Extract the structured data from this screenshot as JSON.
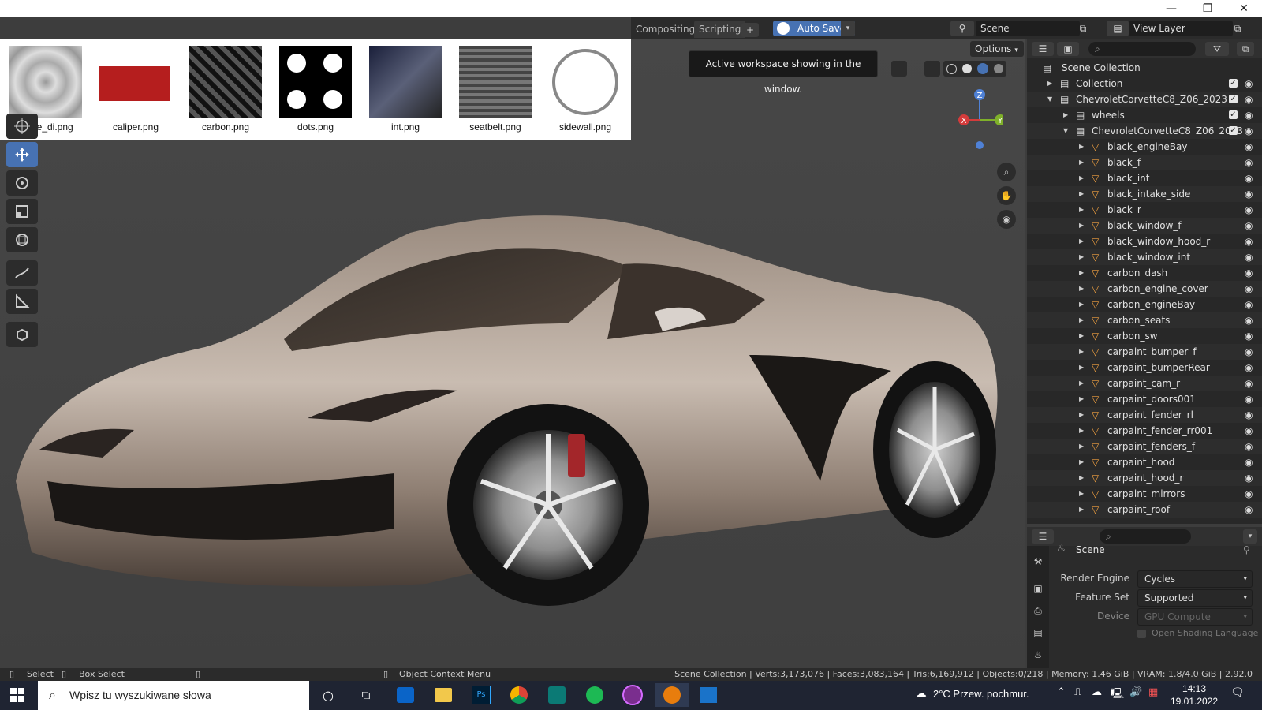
{
  "window": {
    "minimize": "—",
    "restore": "❐",
    "close": "✕"
  },
  "workspace_tabs": [
    {
      "label": "Compositing"
    },
    {
      "label": "Scripting"
    },
    {
      "label": "+"
    }
  ],
  "header": {
    "auto_save": "Auto Save",
    "scene_name": "Scene",
    "view_layer": "View Layer",
    "options": "Options"
  },
  "tooltip": "Active workspace showing in the window.",
  "image_strip": [
    {
      "name": "brake_di.png"
    },
    {
      "name": "caliper.png"
    },
    {
      "name": "carbon.png"
    },
    {
      "name": "dots.png"
    },
    {
      "name": "int.png"
    },
    {
      "name": "seatbelt.png"
    },
    {
      "name": "sidewall.png"
    }
  ],
  "gizmo": {
    "z": "Z",
    "y": "Y",
    "x": "X"
  },
  "outliner": {
    "title": "Scene Collection",
    "rows": [
      {
        "label": "Collection",
        "indent": 1
      },
      {
        "label": "ChevroletCorvetteC8_Z06_2023",
        "indent": 1
      },
      {
        "label": "wheels",
        "indent": 2
      },
      {
        "label": "ChevroletCorvetteC8_Z06_2023",
        "indent": 2
      },
      {
        "label": "black_engineBay",
        "indent": 3
      },
      {
        "label": "black_f",
        "indent": 3
      },
      {
        "label": "black_int",
        "indent": 3
      },
      {
        "label": "black_intake_side",
        "indent": 3
      },
      {
        "label": "black_r",
        "indent": 3
      },
      {
        "label": "black_window_f",
        "indent": 3
      },
      {
        "label": "black_window_hood_r",
        "indent": 3
      },
      {
        "label": "black_window_int",
        "indent": 3
      },
      {
        "label": "carbon_dash",
        "indent": 3
      },
      {
        "label": "carbon_engine_cover",
        "indent": 3
      },
      {
        "label": "carbon_engineBay",
        "indent": 3
      },
      {
        "label": "carbon_seats",
        "indent": 3
      },
      {
        "label": "carbon_sw",
        "indent": 3
      },
      {
        "label": "carpaint_bumper_f",
        "indent": 3
      },
      {
        "label": "carpaint_bumperRear",
        "indent": 3
      },
      {
        "label": "carpaint_cam_r",
        "indent": 3
      },
      {
        "label": "carpaint_doors001",
        "indent": 3
      },
      {
        "label": "carpaint_fender_rl",
        "indent": 3
      },
      {
        "label": "carpaint_fender_rr001",
        "indent": 3
      },
      {
        "label": "carpaint_fenders_f",
        "indent": 3
      },
      {
        "label": "carpaint_hood",
        "indent": 3
      },
      {
        "label": "carpaint_hood_r",
        "indent": 3
      },
      {
        "label": "carpaint_mirrors",
        "indent": 3
      },
      {
        "label": "carpaint_roof",
        "indent": 3
      }
    ]
  },
  "properties": {
    "scene_label": "Scene",
    "render_engine_label": "Render Engine",
    "render_engine_value": "Cycles",
    "feature_set_label": "Feature Set",
    "feature_set_value": "Supported",
    "device_label": "Device",
    "device_value": "GPU Compute",
    "osl_label": "Open Shading Language"
  },
  "statusbar": {
    "select": "Select",
    "box_select": "Box Select",
    "context_menu": "Object Context Menu",
    "stats": "Scene Collection | Verts:3,173,076 | Faces:3,083,164 | Tris:6,169,912 | Objects:0/218 | Memory: 1.46 GiB | VRAM: 1.8/4.0 GiB | 2.92.0"
  },
  "taskbar": {
    "search_placeholder": "Wpisz tu wyszukiwane słowa",
    "weather": "2°C  Przew. pochmur.",
    "time": "14:13",
    "date": "19.01.2022"
  }
}
